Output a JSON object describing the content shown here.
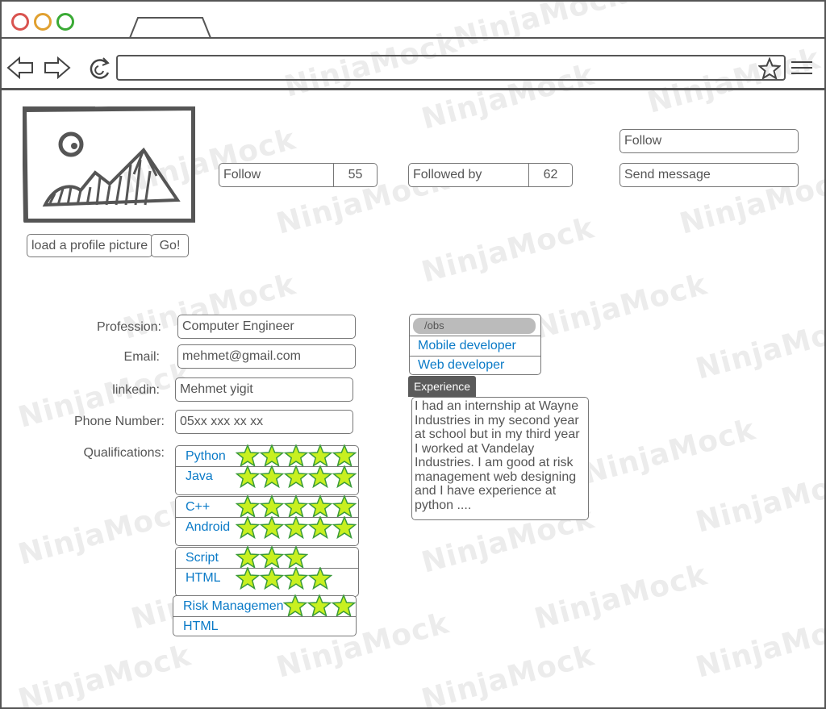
{
  "watermark": "NinjaMock",
  "profile": {
    "load_picture_label": "load a profile picture",
    "go_label": "Go!"
  },
  "stats": {
    "follow_label": "Follow",
    "follow_count": "55",
    "followed_by_label": "Followed by",
    "followed_by_count": "62"
  },
  "actions": {
    "follow_label": "Follow",
    "send_message_label": "Send message"
  },
  "form": {
    "profession_label": "Profession:",
    "profession_value": "Computer Engineer",
    "email_label": "Email:",
    "email_value": "mehmet@gmail.com",
    "linkedin_label": "linkedin:",
    "linkedin_value": "Mehmet yigit",
    "phone_label": "Phone Number:",
    "phone_value": "05xx xxx xx xx",
    "qualifications_label": "Qualifications:"
  },
  "qualifications": [
    {
      "name": "Python",
      "stars": 5
    },
    {
      "name": "Java",
      "stars": 5
    },
    {
      "name": "C++",
      "stars": 5
    },
    {
      "name": "Android",
      "stars": 5
    },
    {
      "name": "Script",
      "stars": 3
    },
    {
      "name": "HTML",
      "stars": 4
    },
    {
      "name": "Risk Managemen",
      "stars": 3
    },
    {
      "name": "HTML",
      "stars": 0
    }
  ],
  "jobs": {
    "header": "/obs",
    "items": [
      "Mobile developer",
      "Web developer"
    ]
  },
  "experience": {
    "tab_label": "Experience",
    "text": "I had an internship at Wayne Industries in my second year at school but in my third year I worked at Vandelay Industries. I am good at risk management web designing and I have experience at python ...."
  },
  "colors": {
    "close": "#d9534f",
    "minimize": "#e0a030",
    "maximize": "#3aaa35",
    "star_fill": "#c8f020",
    "star_stroke": "#3a9a3a",
    "link_blue": "#0a7ac7"
  },
  "icons": [
    "back-arrow-icon",
    "forward-arrow-icon",
    "reload-icon",
    "star-bookmark-icon",
    "hamburger-menu-icon",
    "image-placeholder-icon"
  ]
}
